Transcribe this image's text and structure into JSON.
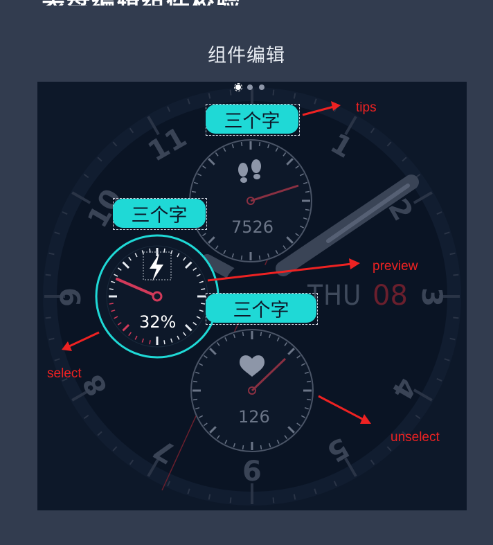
{
  "header": {
    "top_title": "表盘编辑组件校验",
    "page_title": "组件编辑"
  },
  "watch": {
    "dots": 3,
    "active_dot": 0,
    "hour_numerals": [
      "11",
      "1",
      "10",
      "2",
      "9",
      "3",
      "8",
      "4",
      "7",
      "6",
      "5"
    ],
    "date_day": "THU",
    "date_num": "08",
    "steps_value": "7526",
    "heart_value": "126",
    "battery_value": "32%",
    "tips": [
      {
        "label": "三个字"
      },
      {
        "label": "三个字"
      },
      {
        "label": "三个字"
      }
    ],
    "accent_color": "#1fd9d6",
    "hand_color": "#d23a5a"
  },
  "annotations": {
    "tips": "tips",
    "preview": "preview",
    "select": "select",
    "unselect": "unselect",
    "arrow_color": "#ee2222"
  },
  "icons": [
    "footsteps-icon",
    "heart-icon",
    "lightning-icon"
  ]
}
